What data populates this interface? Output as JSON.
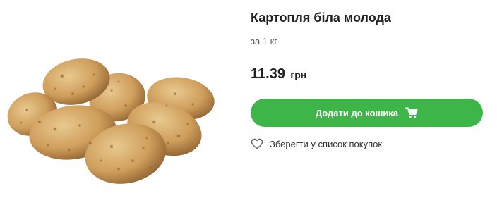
{
  "product": {
    "title": "Картопля біла молода",
    "unit": "за 1 кг",
    "price": "11.39",
    "currency": "грн",
    "image_icon": "potatoes-image"
  },
  "actions": {
    "add_to_cart_label": "Додати до кошика",
    "add_to_cart_icon": "cart-icon",
    "save_label": "Зберегти у список покупок",
    "save_icon": "heart-icon"
  },
  "colors": {
    "accent": "#3db549",
    "text": "#222222",
    "muted": "#555555"
  }
}
